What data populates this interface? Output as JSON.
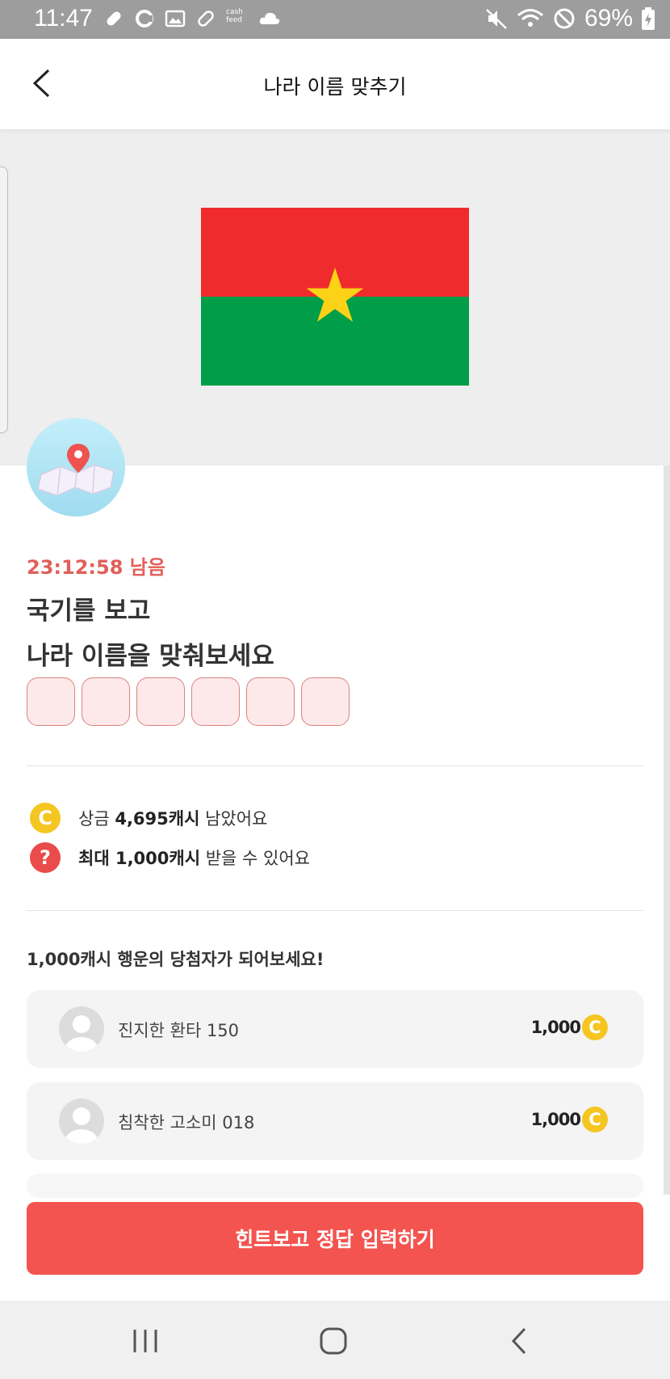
{
  "status_bar": {
    "time": "11:47",
    "battery": "69%",
    "left_icons": [
      "pill-icon",
      "pill-icon",
      "image-icon",
      "pill-icon",
      "cashfeed-icon",
      "cloud-icon"
    ],
    "left_icon_text": "cash feed",
    "right_icons": [
      "mute-icon",
      "wifi-icon",
      "block-icon",
      "battery-icon"
    ]
  },
  "header": {
    "title": "나라 이름 맞추기",
    "back_icon": "chevron-left-icon"
  },
  "quiz": {
    "flag": {
      "top_color": "#ef2b2d",
      "bottom_color": "#009e49",
      "star_color": "#fcd116"
    },
    "timer": "23:12:58 남음",
    "question_line1": "국기를 보고",
    "question_line2": "나라 이름을 맞춰보세요",
    "answer_slots": 6
  },
  "info": {
    "prize_label": "상금",
    "prize_value": "4,695캐시",
    "prize_suffix": "남았어요",
    "coin_symbol": "C",
    "max_label": "최대 1,000캐시",
    "max_suffix": "받을 수 있어요",
    "question_symbol": "?"
  },
  "lucky": {
    "title": "1,000캐시 행운의 당첨자가 되어보세요!",
    "winners": [
      {
        "name": "진지한 환타 150",
        "amount": "1,000"
      },
      {
        "name": "침착한 고소미 018",
        "amount": "1,000"
      }
    ]
  },
  "cta": {
    "label": "힌트보고 정답 입력하기"
  },
  "colors": {
    "accent": "#f45450",
    "timer": "#e0605a",
    "coin": "#f5c521"
  },
  "navbar": {
    "icons": [
      "recent-apps-icon",
      "home-icon",
      "back-icon"
    ]
  }
}
